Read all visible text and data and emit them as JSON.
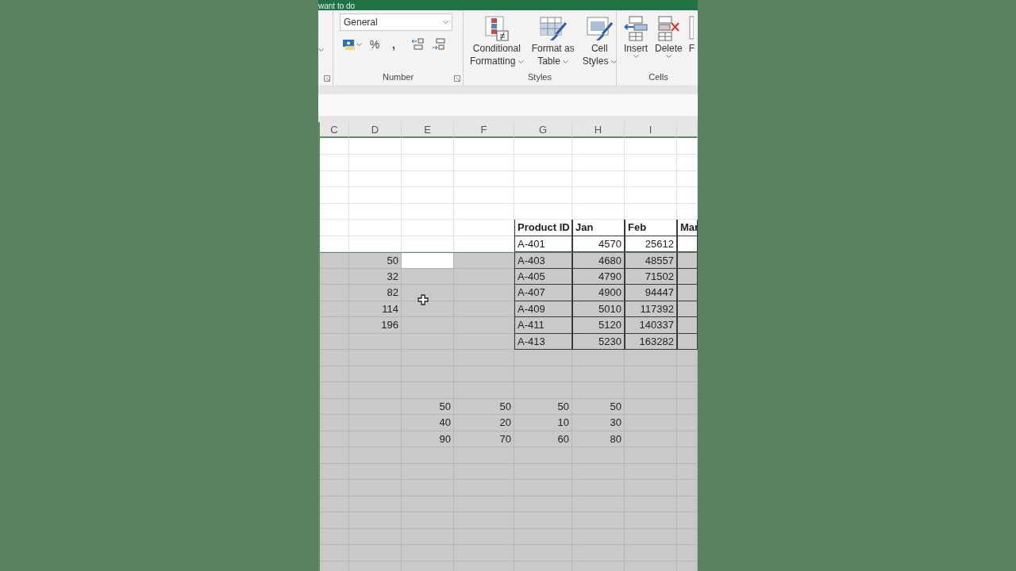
{
  "title_bar": {
    "text": "want to do"
  },
  "ribbon": {
    "number": {
      "format": {
        "value": "General"
      },
      "buttons": [
        {
          "kind": "currency"
        },
        {
          "kind": "percent",
          "label": "%"
        },
        {
          "kind": "comma",
          "label": ","
        },
        {
          "kind": "increase-decimal"
        },
        {
          "kind": "decrease-decimal"
        }
      ],
      "label": "Number"
    },
    "styles": {
      "buttons": [
        {
          "kind": "conditional",
          "lines": [
            "Conditional",
            "Formatting"
          ]
        },
        {
          "kind": "table",
          "lines": [
            "Format as",
            "Table"
          ]
        },
        {
          "kind": "cell-styles",
          "lines": [
            "Cell",
            "Styles"
          ]
        }
      ],
      "label": "Styles"
    },
    "cells": {
      "buttons": [
        {
          "kind": "insert",
          "lines": [
            "Insert"
          ]
        },
        {
          "kind": "delete",
          "lines": [
            "Delete"
          ]
        },
        {
          "kind": "format",
          "lines": [
            "F"
          ]
        }
      ],
      "label": "Cells"
    }
  },
  "columns": [
    "C",
    "D",
    "E",
    "F",
    "G",
    "H",
    "I"
  ],
  "rows": [
    {
      "kind": "blank",
      "shaded": false,
      "cells": {}
    },
    {
      "kind": "blank",
      "shaded": false,
      "cells": {}
    },
    {
      "kind": "blank",
      "shaded": false,
      "cells": {}
    },
    {
      "kind": "blank",
      "shaded": false,
      "cells": {}
    },
    {
      "kind": "blank",
      "shaded": false,
      "cells": {}
    },
    {
      "kind": "table-header",
      "shaded": false,
      "cells": {
        "G": "Product ID",
        "H": "Jan",
        "I": "Feb",
        "J": "Mar"
      }
    },
    {
      "kind": "table-row",
      "shaded": false,
      "cells": {
        "G": "A-401",
        "H": "4570",
        "I": "25612"
      }
    },
    {
      "kind": "table-row",
      "shaded": true,
      "cells": {
        "D": "50",
        "E": {
          "active": true
        },
        "G": "A-403",
        "H": "4680",
        "I": "48557"
      }
    },
    {
      "kind": "table-row",
      "shaded": true,
      "cells": {
        "D": "32",
        "G": "A-405",
        "H": "4790",
        "I": "71502"
      }
    },
    {
      "kind": "table-row",
      "shaded": true,
      "cells": {
        "D": "82",
        "G": "A-407",
        "H": "4900",
        "I": "94447"
      }
    },
    {
      "kind": "table-row",
      "shaded": true,
      "cells": {
        "D": "114",
        "G": "A-409",
        "H": "5010",
        "I": "117392"
      }
    },
    {
      "kind": "table-row",
      "shaded": true,
      "cells": {
        "D": "196",
        "G": "A-411",
        "H": "5120",
        "I": "140337"
      }
    },
    {
      "kind": "table-row",
      "shaded": true,
      "cells": {
        "G": "A-413",
        "H": "5230",
        "I": "163282"
      }
    },
    {
      "kind": "blank",
      "shaded": true,
      "cells": {}
    },
    {
      "kind": "blank",
      "shaded": true,
      "cells": {}
    },
    {
      "kind": "blank",
      "shaded": true,
      "cells": {}
    },
    {
      "kind": "values",
      "shaded": true,
      "cells": {
        "E": "50",
        "F": "50",
        "G": "50",
        "H": "50"
      }
    },
    {
      "kind": "values",
      "shaded": true,
      "cells": {
        "E": "40",
        "F": "20",
        "G": "10",
        "H": "30"
      }
    },
    {
      "kind": "values",
      "shaded": true,
      "cells": {
        "E": "90",
        "F": "70",
        "G": "60",
        "H": "80"
      }
    },
    {
      "kind": "blank",
      "shaded": true,
      "cells": {}
    },
    {
      "kind": "blank",
      "shaded": true,
      "cells": {}
    },
    {
      "kind": "blank",
      "shaded": true,
      "cells": {}
    },
    {
      "kind": "blank",
      "shaded": true,
      "cells": {}
    },
    {
      "kind": "blank",
      "shaded": true,
      "cells": {}
    },
    {
      "kind": "blank",
      "shaded": true,
      "cells": {}
    },
    {
      "kind": "blank",
      "shaded": true,
      "cells": {}
    },
    {
      "kind": "blank",
      "shaded": true,
      "cells": {}
    }
  ]
}
